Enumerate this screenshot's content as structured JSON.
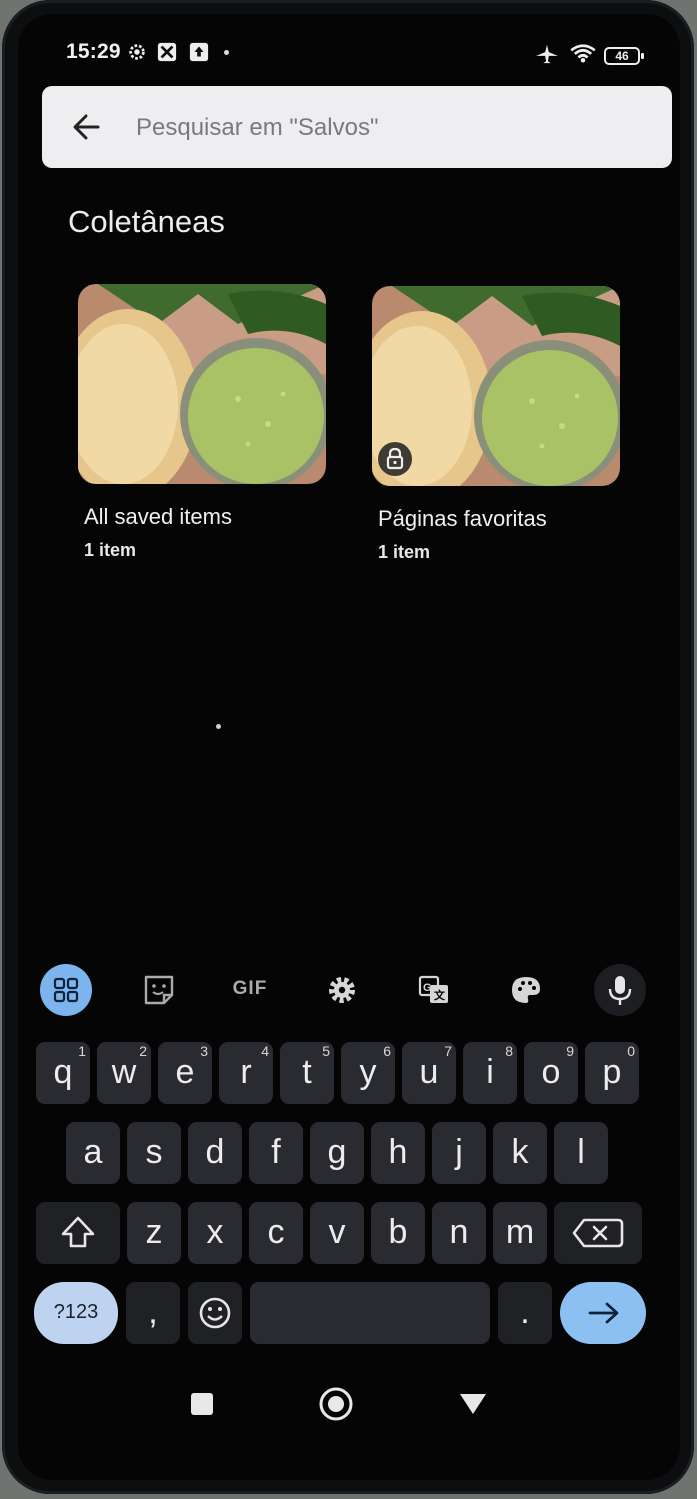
{
  "status_bar": {
    "time": "15:29",
    "battery": "46"
  },
  "search": {
    "placeholder": "Pesquisar em \"Salvos\""
  },
  "section_title": "Coletâneas",
  "collections": [
    {
      "title": "All saved items",
      "count": "1 item",
      "locked": false
    },
    {
      "title": "Páginas favoritas",
      "count": "1 item",
      "locked": true
    }
  ],
  "keyboard": {
    "toolbar": {
      "gif_label": "GIF"
    },
    "row1": [
      {
        "k": "q",
        "n": "1"
      },
      {
        "k": "w",
        "n": "2"
      },
      {
        "k": "e",
        "n": "3"
      },
      {
        "k": "r",
        "n": "4"
      },
      {
        "k": "t",
        "n": "5"
      },
      {
        "k": "y",
        "n": "6"
      },
      {
        "k": "u",
        "n": "7"
      },
      {
        "k": "i",
        "n": "8"
      },
      {
        "k": "o",
        "n": "9"
      },
      {
        "k": "p",
        "n": "0"
      }
    ],
    "row2": [
      "a",
      "s",
      "d",
      "f",
      "g",
      "h",
      "j",
      "k",
      "l"
    ],
    "row3": [
      "z",
      "x",
      "c",
      "v",
      "b",
      "n",
      "m"
    ],
    "row4": {
      "symbols": "?123",
      "comma": ",",
      "period": "."
    }
  },
  "colors": {
    "accent": "#7cb4ee",
    "key_bg": "#2a2b30",
    "search_bg": "#eeeef1"
  }
}
